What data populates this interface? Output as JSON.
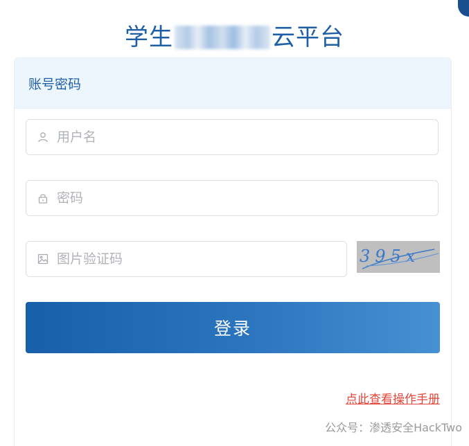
{
  "page": {
    "title_prefix": "学生",
    "title_suffix": "云平台"
  },
  "tabs": [
    {
      "label": "账号密码",
      "active": true
    }
  ],
  "form": {
    "username": {
      "placeholder": "用户名",
      "value": "",
      "icon": "user-icon"
    },
    "password": {
      "placeholder": "密码",
      "value": "",
      "icon": "lock-icon"
    },
    "captcha": {
      "placeholder": "图片验证码",
      "value": "",
      "icon": "image-icon",
      "image_text": "395x"
    },
    "login_label": "登录"
  },
  "manual_link": "点此查看操作手册",
  "watermark": "公众号：渗透安全HackTwo",
  "colors": {
    "title": "#1f5fa6",
    "header_bg": "#eef6fd",
    "button_start": "#175fa9",
    "button_end": "#4690d3",
    "link": "#e0463a",
    "captcha_bg": "#bfbfbf",
    "captcha_text": "#3a78c9"
  }
}
